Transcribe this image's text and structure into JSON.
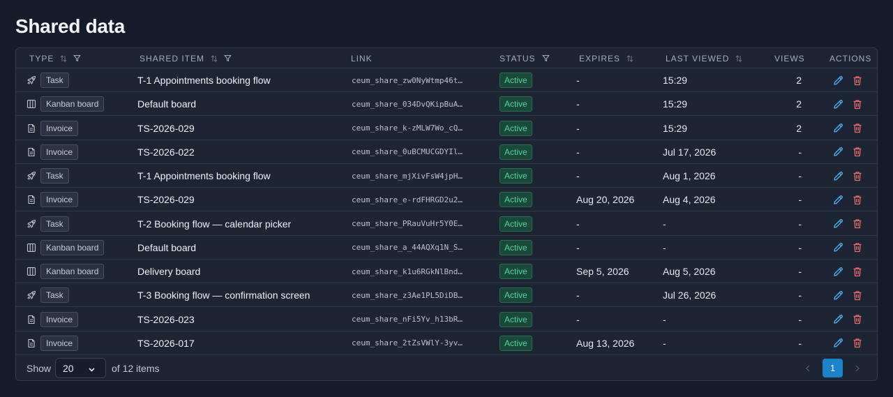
{
  "page": {
    "title": "Shared data"
  },
  "columns": {
    "type": "TYPE",
    "shared_item": "SHARED ITEM",
    "link": "LINK",
    "status": "STATUS",
    "expires": "EXPIRES",
    "last_viewed": "LAST VIEWED",
    "views": "VIEWS",
    "actions": "ACTIONS"
  },
  "rows": [
    {
      "type_icon": "rocket-icon",
      "type": "Task",
      "title": "T-1 Appointments booking flow",
      "link": "ceum_share_zw0NyWtmp46t…",
      "status": "Active",
      "expires": "-",
      "last_viewed": "15:29",
      "views": "2"
    },
    {
      "type_icon": "kanban-icon",
      "type": "Kanban board",
      "title": "Default board",
      "link": "ceum_share_034DvQKipBuA…",
      "status": "Active",
      "expires": "-",
      "last_viewed": "15:29",
      "views": "2"
    },
    {
      "type_icon": "document-icon",
      "type": "Invoice",
      "title": "TS-2026-029",
      "link": "ceum_share_k-zMLW7Wo_cQ…",
      "status": "Active",
      "expires": "-",
      "last_viewed": "15:29",
      "views": "2"
    },
    {
      "type_icon": "document-icon",
      "type": "Invoice",
      "title": "TS-2026-022",
      "link": "ceum_share_0uBCMUCGDYIl…",
      "status": "Active",
      "expires": "-",
      "last_viewed": "Jul 17, 2026",
      "views": "-"
    },
    {
      "type_icon": "rocket-icon",
      "type": "Task",
      "title": "T-1 Appointments booking flow",
      "link": "ceum_share_mjXivFsW4jpH…",
      "status": "Active",
      "expires": "-",
      "last_viewed": "Aug 1, 2026",
      "views": "-"
    },
    {
      "type_icon": "document-icon",
      "type": "Invoice",
      "title": "TS-2026-029",
      "link": "ceum_share_e-rdFHRGD2u2…",
      "status": "Active",
      "expires": "Aug 20, 2026",
      "last_viewed": "Aug 4, 2026",
      "views": "-"
    },
    {
      "type_icon": "rocket-icon",
      "type": "Task",
      "title": "T-2 Booking flow — calendar picker",
      "link": "ceum_share_PRauVuHr5Y0E…",
      "status": "Active",
      "expires": "-",
      "last_viewed": "-",
      "views": "-"
    },
    {
      "type_icon": "kanban-icon",
      "type": "Kanban board",
      "title": "Default board",
      "link": "ceum_share_a_44AQXq1N_S…",
      "status": "Active",
      "expires": "-",
      "last_viewed": "-",
      "views": "-"
    },
    {
      "type_icon": "kanban-icon",
      "type": "Kanban board",
      "title": "Delivery board",
      "link": "ceum_share_k1u6RGkNlBnd…",
      "status": "Active",
      "expires": "Sep 5, 2026",
      "last_viewed": "Aug 5, 2026",
      "views": "-"
    },
    {
      "type_icon": "rocket-icon",
      "type": "Task",
      "title": "T-3 Booking flow — confirmation screen",
      "link": "ceum_share_z3Ae1PL5DiDB…",
      "status": "Active",
      "expires": "-",
      "last_viewed": "Jul 26, 2026",
      "views": "-"
    },
    {
      "type_icon": "document-icon",
      "type": "Invoice",
      "title": "TS-2026-023",
      "link": "ceum_share_nFi5Yv_h13bR…",
      "status": "Active",
      "expires": "-",
      "last_viewed": "-",
      "views": "-"
    },
    {
      "type_icon": "document-icon",
      "type": "Invoice",
      "title": "TS-2026-017",
      "link": "ceum_share_2tZsVWlY-3yv…",
      "status": "Active",
      "expires": "Aug 13, 2026",
      "last_viewed": "-",
      "views": "-"
    }
  ],
  "footer": {
    "show_label": "Show",
    "page_size": "20",
    "count_label": "of 12 items",
    "current_page": "1"
  },
  "colors": {
    "background": "#151b2b",
    "accent": "#1b83c9",
    "status_active": "#56d39b",
    "edit": "#49b0ef",
    "delete": "#ee6b6b"
  }
}
